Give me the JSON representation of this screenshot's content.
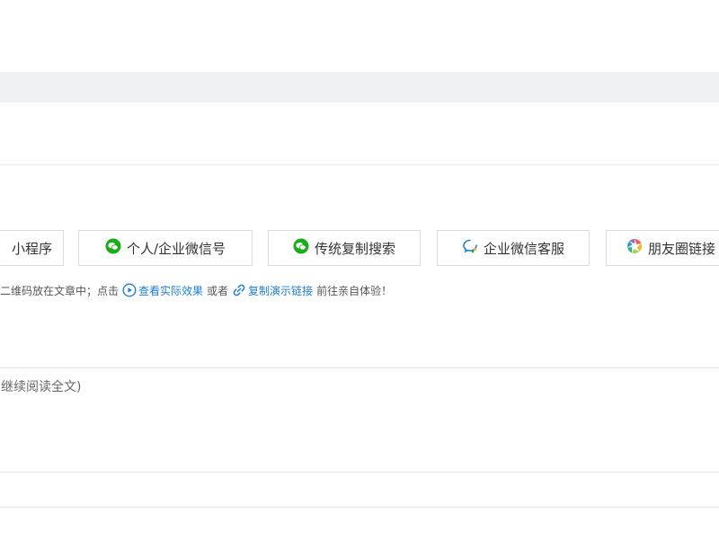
{
  "tabs": [
    {
      "label": "小程序"
    },
    {
      "label": "个人/企业微信号"
    },
    {
      "label": "传统复制搜索"
    },
    {
      "label": "企业微信客服"
    },
    {
      "label": "朋友圈链接"
    }
  ],
  "hint": {
    "prefix": "二维码放在文章中；点击",
    "view_link": "查看实际效果",
    "or_text": "或者",
    "copy_link": "复制演示链接",
    "suffix": "前往亲自体验！"
  },
  "field": {
    "text": "继续阅读全文)"
  },
  "colors": {
    "accent": "#1e7fd6",
    "wechat_green": "#1aad19",
    "band": "#eff1f5",
    "border": "#d9dce1"
  }
}
